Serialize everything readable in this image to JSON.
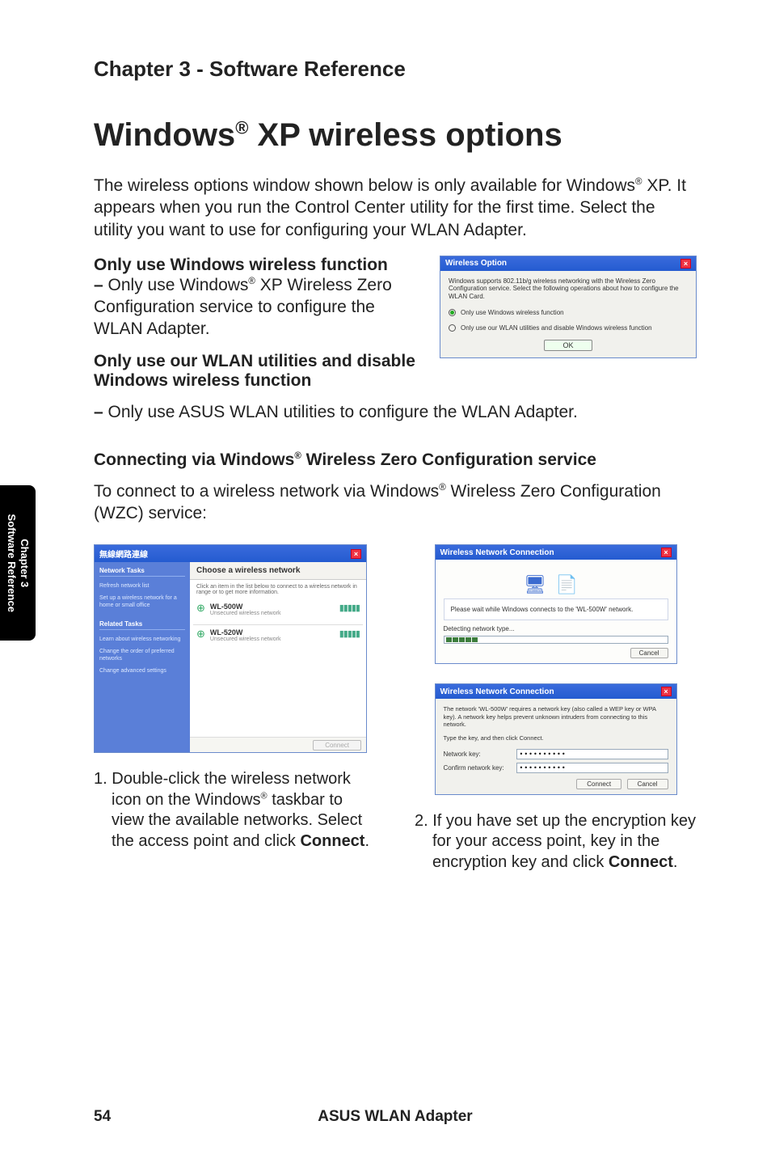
{
  "header": {
    "chapter": "Chapter 3 - Software Reference"
  },
  "title": {
    "pre": "Windows",
    "reg": "®",
    "post": " XP wireless options"
  },
  "intro": {
    "t1": "The wireless options window shown below is only available for Windows",
    "reg": "®",
    "t2": " XP. It appears when you run the Control Center utility for the first time. Select the utility you want to use for configuring your WLAN Adapter."
  },
  "opt1": {
    "title": "Only use Windows wireless function",
    "dash": "– ",
    "p1": "Only use Windows",
    "reg": "®",
    "p2": " XP Wireless Zero Configuration service to configure the WLAN Adapter."
  },
  "opt2": {
    "title": "Only use our WLAN utilities and disable Windows wireless function",
    "dash": "– ",
    "body": "Only use ASUS WLAN utilities to configure the WLAN Adapter."
  },
  "sub": {
    "pre": "Connecting via Windows",
    "reg": "®",
    "post": " Wireless Zero Configuration service"
  },
  "sub_body": {
    "t1": "To connect to a wireless network via Windows",
    "reg": "®",
    "t2": " Wireless Zero Configuration (WZC) service:"
  },
  "wo": {
    "title": "Wireless Option",
    "desc": "Windows supports 802.11b/g wireless networking with the Wireless Zero Configuration service. Select the following operations about how to configure the WLAN Card.",
    "o1": "Only use Windows wireless function",
    "o2": "Only use our WLAN utilities and disable Windows wireless function",
    "ok": "OK"
  },
  "wn": {
    "title": "無線網路連線",
    "side_sec1": "Network Tasks",
    "side_l1": "Refresh network list",
    "side_l2": "Set up a wireless network for a home or small office",
    "side_sec2": "Related Tasks",
    "side_l3": "Learn about wireless networking",
    "side_l4": "Change the order of preferred networks",
    "side_l5": "Change advanced settings",
    "head": "Choose a wireless network",
    "hint": "Click an item in the list below to connect to a wireless network in range or to get more information.",
    "n1_name": "WL-500W",
    "n1_sub": "Unsecured wireless network",
    "n2_name": "WL-520W",
    "n2_sub": "Unsecured wireless network",
    "connect": "Connect"
  },
  "prog": {
    "title": "Wireless Network Connection",
    "msg": "Please wait while Windows connects to the 'WL-500W' network.",
    "det": "Detecting network type...",
    "cancel": "Cancel"
  },
  "key": {
    "title": "Wireless Network Connection",
    "desc": "The network 'WL-500W' requires a network key (also called a WEP key or WPA key). A network key helps prevent unknown intruders from connecting to this network.",
    "hint": "Type the key, and then click Connect.",
    "l1": "Network key:",
    "l2": "Confirm network key:",
    "val": "••••••••••",
    "connect": "Connect",
    "cancel": "Cancel"
  },
  "step1": {
    "num": "1. ",
    "t1": "Double-click the wireless network icon on the Windows",
    "reg": "®",
    "t2": " taskbar to view the available networks. Select the access point and click ",
    "b": "Connect",
    "t3": "."
  },
  "step2": {
    "num": "2. ",
    "t1": "If you have set up the encryption key for your access point, key in the encryption key and click ",
    "b": "Connect",
    "t2": "."
  },
  "sidetab": {
    "l1": "Chapter 3",
    "l2": "Software Reference"
  },
  "footer": {
    "page": "54",
    "prod": "ASUS WLAN Adapter"
  }
}
